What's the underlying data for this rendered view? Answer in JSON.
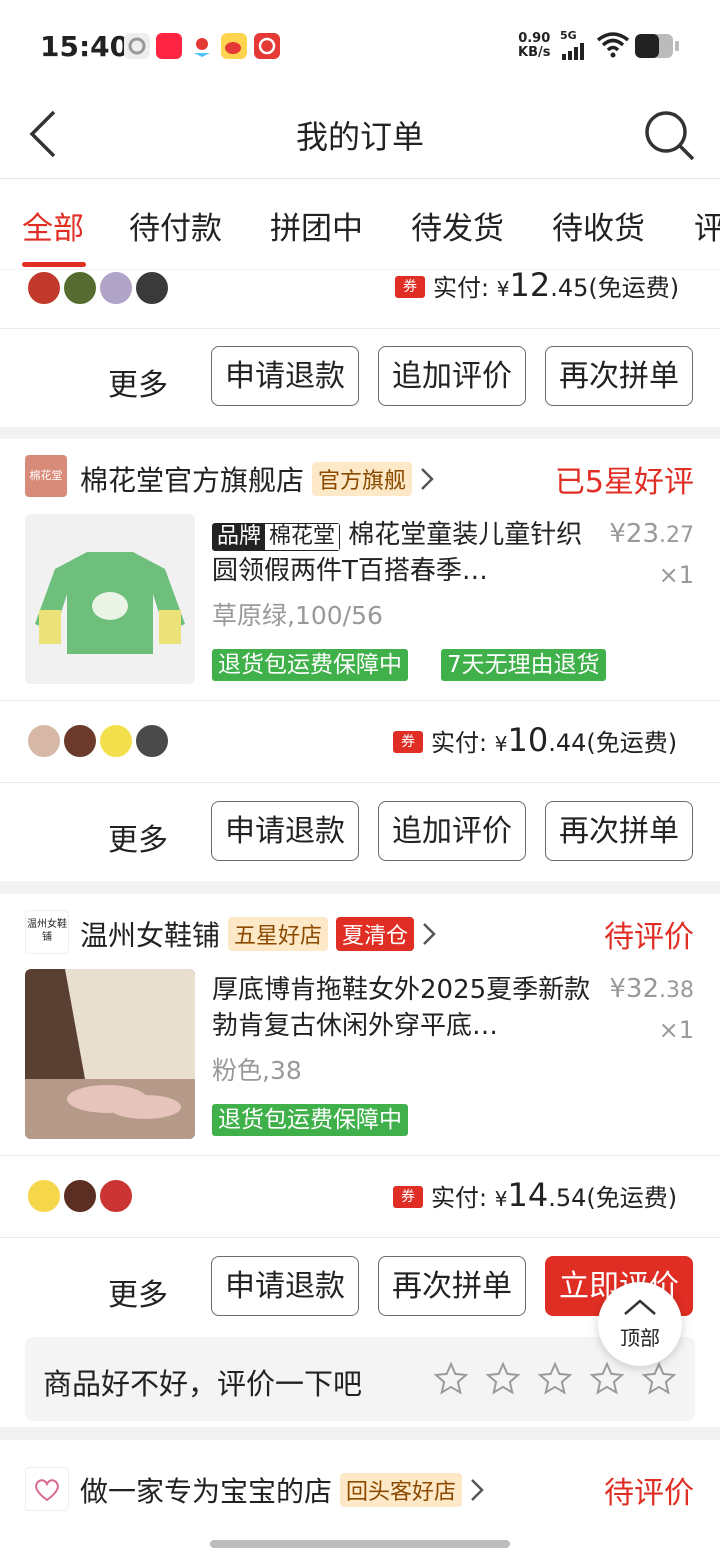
{
  "status_bar": {
    "time": "15:40",
    "net_speed_value": "0.90",
    "net_speed_unit": "KB/s",
    "signal": "5G",
    "icons": [
      "settings-icon",
      "xiaohongshu-icon",
      "map-icon",
      "weibo-icon",
      "netease-music-icon"
    ]
  },
  "header": {
    "title": "我的订单"
  },
  "tabs": [
    "全部",
    "待付款",
    "拼团中",
    "待发货",
    "待收货",
    "评"
  ],
  "orders": [
    {
      "paid_prefix": "实付:",
      "paid_yen": "¥",
      "paid_int": "12",
      "paid_dec": ".45",
      "paid_suffix": "(免运费)",
      "coupon": "券",
      "more": "更多",
      "buttons": [
        "申请退款",
        "追加评价",
        "再次拼单"
      ]
    },
    {
      "store_name": "棉花堂官方旗舰店",
      "store_logo_text": "棉花堂",
      "store_badge": "官方旗舰",
      "status": "已5星好评",
      "brand_key": "品牌",
      "brand_value": "棉花堂",
      "product_title": "棉花堂童装儿童针织圆领假两件T百搭春季…",
      "price_int": "¥23",
      "price_dec": ".27",
      "qty": "×1",
      "spec": "草原绿,100/56",
      "tags": [
        "退货包运费保障中",
        "7天无理由退货"
      ],
      "paid_prefix": "实付:",
      "paid_yen": "¥",
      "paid_int": "10",
      "paid_dec": ".44",
      "paid_suffix": "(免运费)",
      "coupon": "券",
      "more": "更多",
      "buttons": [
        "申请退款",
        "追加评价",
        "再次拼单"
      ]
    },
    {
      "store_name": "温州女鞋铺",
      "store_logo_text": "温州女鞋铺",
      "store_badge": "五星好店",
      "store_badge2": "夏清仓",
      "status": "待评价",
      "product_title": "厚底博肯拖鞋女外2025夏季新款勃肯复古休闲外穿平底…",
      "price_int": "¥32",
      "price_dec": ".38",
      "qty": "×1",
      "spec": "粉色,38",
      "tags": [
        "退货包运费保障中"
      ],
      "paid_prefix": "实付:",
      "paid_yen": "¥",
      "paid_int": "14",
      "paid_dec": ".54",
      "paid_suffix": "(免运费)",
      "coupon": "券",
      "more": "更多",
      "buttons": [
        "申请退款",
        "再次拼单",
        "立即评价"
      ],
      "rate_prompt": "商品好不好，评价一下吧",
      "rating_stars": 0
    },
    {
      "store_name": "做一家专为宝宝的店",
      "store_badge": "回头客好店",
      "status": "待评价"
    }
  ],
  "float_top_label": "顶部",
  "colors": {
    "accent": "#e02e24",
    "green_tag": "#40b04a"
  }
}
